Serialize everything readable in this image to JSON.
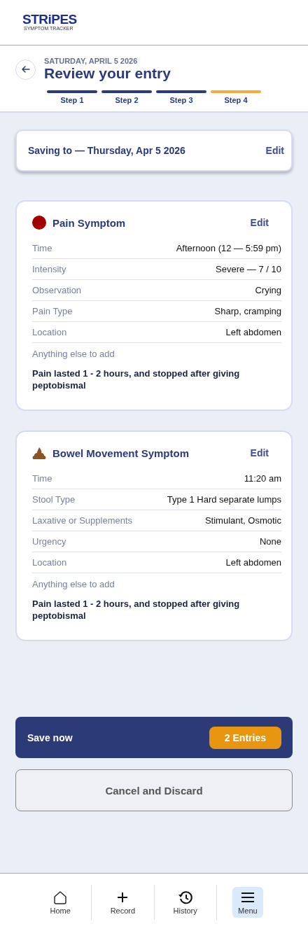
{
  "logo": {
    "name": "STRiPES",
    "tagline": "SYMPTOM TRACKER"
  },
  "header": {
    "date": "SATURDAY, APRIL 5 2026",
    "title": "Review your entry"
  },
  "steps": [
    {
      "label": "Step 1",
      "selected": false
    },
    {
      "label": "Step 2",
      "selected": false
    },
    {
      "label": "Step 3",
      "selected": false
    },
    {
      "label": "Step 4",
      "selected": true
    }
  ],
  "saving": {
    "label": "Saving to — Thursday, Apr 5 2026",
    "action": "Edit"
  },
  "symptoms": [
    {
      "kind": "pain",
      "title": "Pain Symptom",
      "action": "Edit",
      "fields": [
        {
          "label": "Time",
          "value": "Afternoon (12 — 5:59 pm)"
        },
        {
          "label": "Intensity",
          "value": "Severe — 7 / 10"
        },
        {
          "label": "Observation",
          "value": "Crying"
        },
        {
          "label": "Pain Type",
          "value": "Sharp, cramping"
        },
        {
          "label": "Location",
          "value": "Left abdomen"
        }
      ],
      "notes_label": "Anything else to add",
      "notes": "Pain lasted 1 - 2 hours, and stopped after giving peptobismal"
    },
    {
      "kind": "bowel",
      "title": "Bowel Movement Symptom",
      "action": "Edit",
      "fields": [
        {
          "label": "Time",
          "value": "11:20 am"
        },
        {
          "label": "Stool Type",
          "value": "Type 1 Hard separate lumps"
        },
        {
          "label": "Laxative or Supplements",
          "value": "Stimulant, Osmotic"
        },
        {
          "label": "Urgency",
          "value": "None"
        },
        {
          "label": "Location",
          "value": "Left abdomen"
        }
      ],
      "notes_label": "Anything else to add",
      "notes": "Pain lasted 1 - 2 hours, and stopped after giving peptobismal"
    }
  ],
  "save": {
    "label": "Save now",
    "badge": "2 Entries"
  },
  "cancel": {
    "label": "Cancel and Discard"
  },
  "nav": [
    {
      "kind": "home",
      "label": "Home",
      "selected": false
    },
    {
      "kind": "record",
      "label": "Record",
      "selected": false
    },
    {
      "kind": "history",
      "label": "History",
      "selected": false
    },
    {
      "kind": "menu",
      "label": "Menu",
      "selected": true
    }
  ]
}
